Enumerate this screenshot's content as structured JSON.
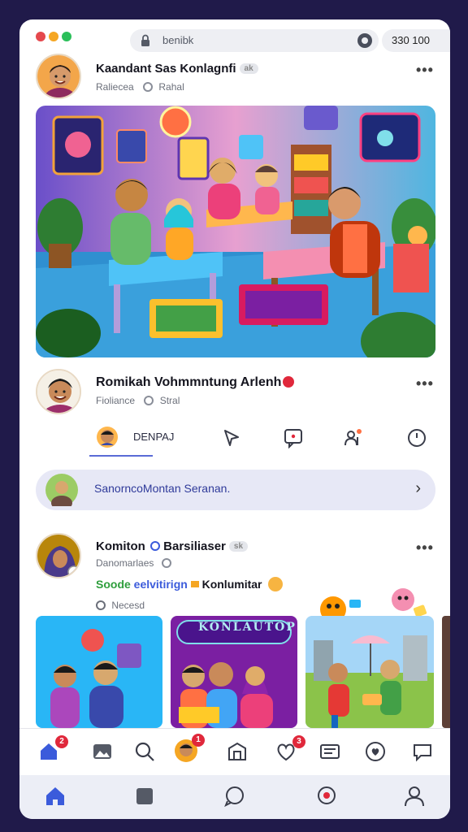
{
  "browser": {
    "url": "benibk",
    "stats": "330 100",
    "dot_colors": [
      "#e5484d",
      "#f5a623",
      "#2bbf5a"
    ]
  },
  "post1": {
    "name": "Kaandant Sas Konlagnfi",
    "tag": "ak",
    "sub_left": "Raliecea",
    "sub_right": "Rahal",
    "more": "•••"
  },
  "post2": {
    "name": "Romikah Vohmmntung Arlenh",
    "sub_left": "Fioliance",
    "sub_right": "Stral",
    "more": "•••"
  },
  "actions": {
    "first_label": "DENPAJ",
    "icons": [
      "avatar-icon",
      "pin-icon",
      "comment-icon",
      "people-icon",
      "clock-icon"
    ]
  },
  "search": {
    "label": "SanorncoMontan Seranan.",
    "chevron": "›"
  },
  "post3": {
    "name": "Komiton",
    "name_extra": "Barsiliaser",
    "tag": "sk",
    "sub_left": "Danomarlaes",
    "line_green": "Soode",
    "line_blue": "eelvitirign",
    "line_dark": "Konlumitar",
    "meta": "Necesd",
    "more": "•••"
  },
  "thumbs": [
    {
      "caption": ""
    },
    {
      "caption": "KONLAUTOP"
    },
    {
      "caption": ""
    }
  ],
  "nav1": {
    "badges": {
      "home": "2",
      "profile": "1",
      "heart": "3"
    }
  },
  "colors": {
    "accent": "#3b5bdb",
    "badge": "#e0283b",
    "search_bg": "#e7e8f6",
    "frame": "#201a4a"
  }
}
